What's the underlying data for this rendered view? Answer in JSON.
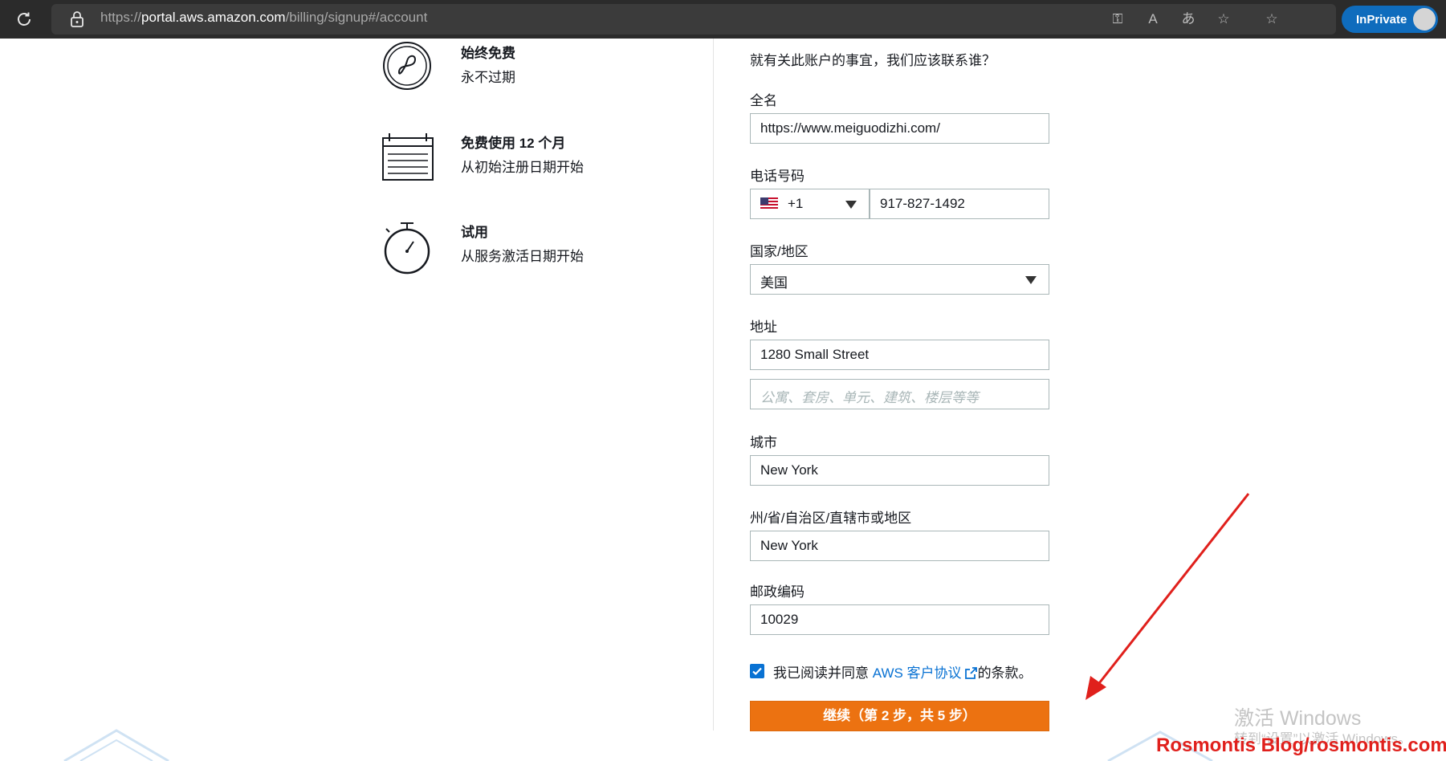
{
  "browser": {
    "url_prefix": "https://",
    "url_host": "portal.aws.amazon.com",
    "url_path": "/billing/signup#/account",
    "inprivate_label": "InPrivate"
  },
  "benefits": [
    {
      "title": "始终免费",
      "subtitle": "永不过期",
      "icon": "infinity-icon"
    },
    {
      "title": "免费使用 12 个月",
      "subtitle": "从初始注册日期开始",
      "icon": "calendar-icon"
    },
    {
      "title": "试用",
      "subtitle": "从服务激活日期开始",
      "icon": "stopwatch-icon"
    }
  ],
  "form": {
    "question": "就有关此账户的事宜，我们应该联系谁？",
    "full_name_label": "全名",
    "full_name_value": "https://www.meiguodizhi.com/",
    "phone_label": "电话号码",
    "country_code": "+1",
    "phone_value": "917-827-1492",
    "country_label": "国家/地区",
    "country_value": "美国",
    "address_label": "地址",
    "address_line1": "1280  Small Street",
    "address_line2_placeholder": "公寓、套房、单元、建筑、楼层等等",
    "city_label": "城市",
    "city_value": "New York",
    "state_label": "州/省/自治区/直辖市或地区",
    "state_value": "New York",
    "zip_label": "邮政编码",
    "zip_value": "10029",
    "agree_prefix": "我已阅读并同意 ",
    "agree_link": "AWS 客户协议",
    "agree_suffix": "的条款。",
    "agree_checked": true,
    "continue_label": "继续（第 2 步，共 5 步）"
  },
  "overlay": {
    "windows_line1": "激活 Windows",
    "windows_line2": "转到“设置”以激活 Windows。",
    "blog_mark": "Rosmontis  Blog/rosmontis.com"
  },
  "colors": {
    "accent": "#ec7211",
    "link": "#0972d3",
    "annotation_arrow": "#e0201c"
  }
}
